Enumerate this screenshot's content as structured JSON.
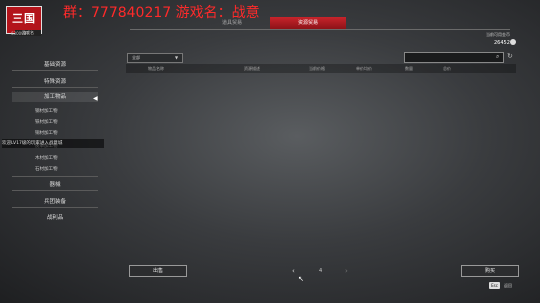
{
  "logo": {
    "text": "三国",
    "sub": "游戏名"
  },
  "player_id": "6300987",
  "overlay_text": "群：777840217  游戏名：战意",
  "tabs": [
    {
      "label": "道具贸易"
    },
    {
      "label": "资源贸易"
    }
  ],
  "currency": {
    "label": "当前可用金币",
    "value": "26452"
  },
  "sidebar": {
    "items": [
      {
        "label": "基础资源"
      },
      {
        "label": "特殊资源"
      },
      {
        "label": "加工物品"
      },
      {
        "label": "器械"
      },
      {
        "label": "兵团装备"
      },
      {
        "label": "战利品"
      }
    ],
    "subitems": [
      {
        "label": "钢材加工物"
      },
      {
        "label": "铁材加工物"
      },
      {
        "label": "铜材加工物"
      },
      {
        "label": "皮革加工物"
      },
      {
        "label": "木材加工物"
      },
      {
        "label": "石材加工物"
      }
    ]
  },
  "welcome": "欢迎LV17级的玩家进入战意城",
  "filter": {
    "selected": "全部"
  },
  "table": {
    "headers": [
      "物品名称",
      "资源描述",
      "当前价格",
      "单价均价",
      "数量",
      "总价"
    ]
  },
  "bottom": {
    "prev_label": "出售",
    "confirm_label": "购买",
    "page": "4",
    "esc_key": "Esc",
    "esc_label": "返回"
  },
  "colors": {
    "accent": "#b3141b",
    "tab_active": "#c8242b"
  }
}
